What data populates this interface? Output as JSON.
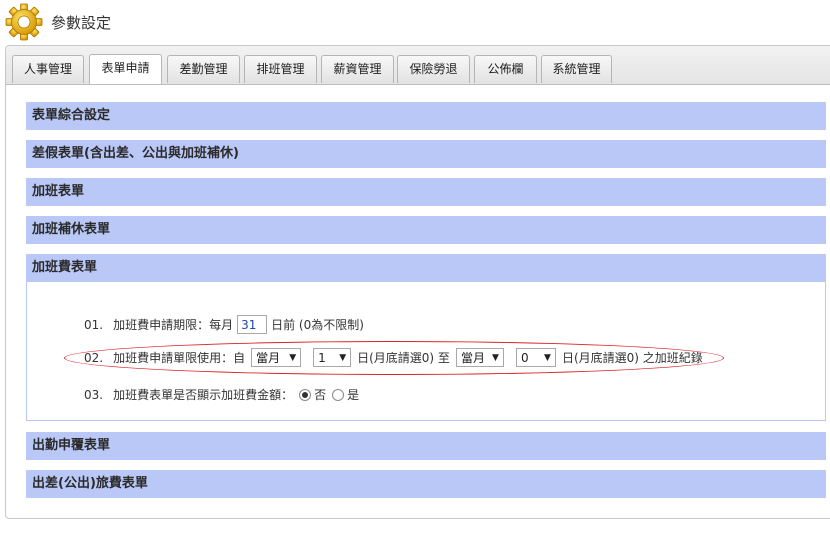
{
  "page": {
    "title": "參數設定"
  },
  "tabs": [
    {
      "label": "人事管理",
      "active": false
    },
    {
      "label": "表單申請",
      "active": true
    },
    {
      "label": "差勤管理",
      "active": false
    },
    {
      "label": "排班管理",
      "active": false
    },
    {
      "label": "薪資管理",
      "active": false
    },
    {
      "label": "保險勞退",
      "active": false
    },
    {
      "label": "公佈欄",
      "active": false
    },
    {
      "label": "系統管理",
      "active": false
    }
  ],
  "sections": [
    {
      "label": "表單綜合設定"
    },
    {
      "label": "差假表單(含出差、公出與加班補休)"
    },
    {
      "label": "加班表單"
    },
    {
      "label": "加班補休表單"
    },
    {
      "label": "加班費表單",
      "expanded": true
    },
    {
      "label": "出勤申覆表單"
    },
    {
      "label": "出差(公出)旅費表單"
    }
  ],
  "overtime_form": {
    "row1": {
      "num": "01.",
      "label": "加班費申請期限：每月",
      "value": "31",
      "suffix": "日前 (0為不限制)"
    },
    "row2": {
      "num": "02.",
      "label": "加班費申請單限使用：自",
      "from_month": "當月",
      "from_day": "1",
      "from_day_suffix": "日(月底請選0) 至",
      "to_month": "當月",
      "to_day": "0",
      "to_day_suffix": "日(月底請選0) 之加班紀錄"
    },
    "row3": {
      "num": "03.",
      "label": "加班費表單是否顯示加班費金額：",
      "option_no": "否",
      "option_yes": "是",
      "selected": "否"
    }
  },
  "colors": {
    "section_bar": "#bac8f7",
    "highlight": "#d9252a",
    "input_text": "#2244aa"
  },
  "icons": {
    "logo": "gear-icon",
    "dropdown": "chevron-down-icon"
  }
}
